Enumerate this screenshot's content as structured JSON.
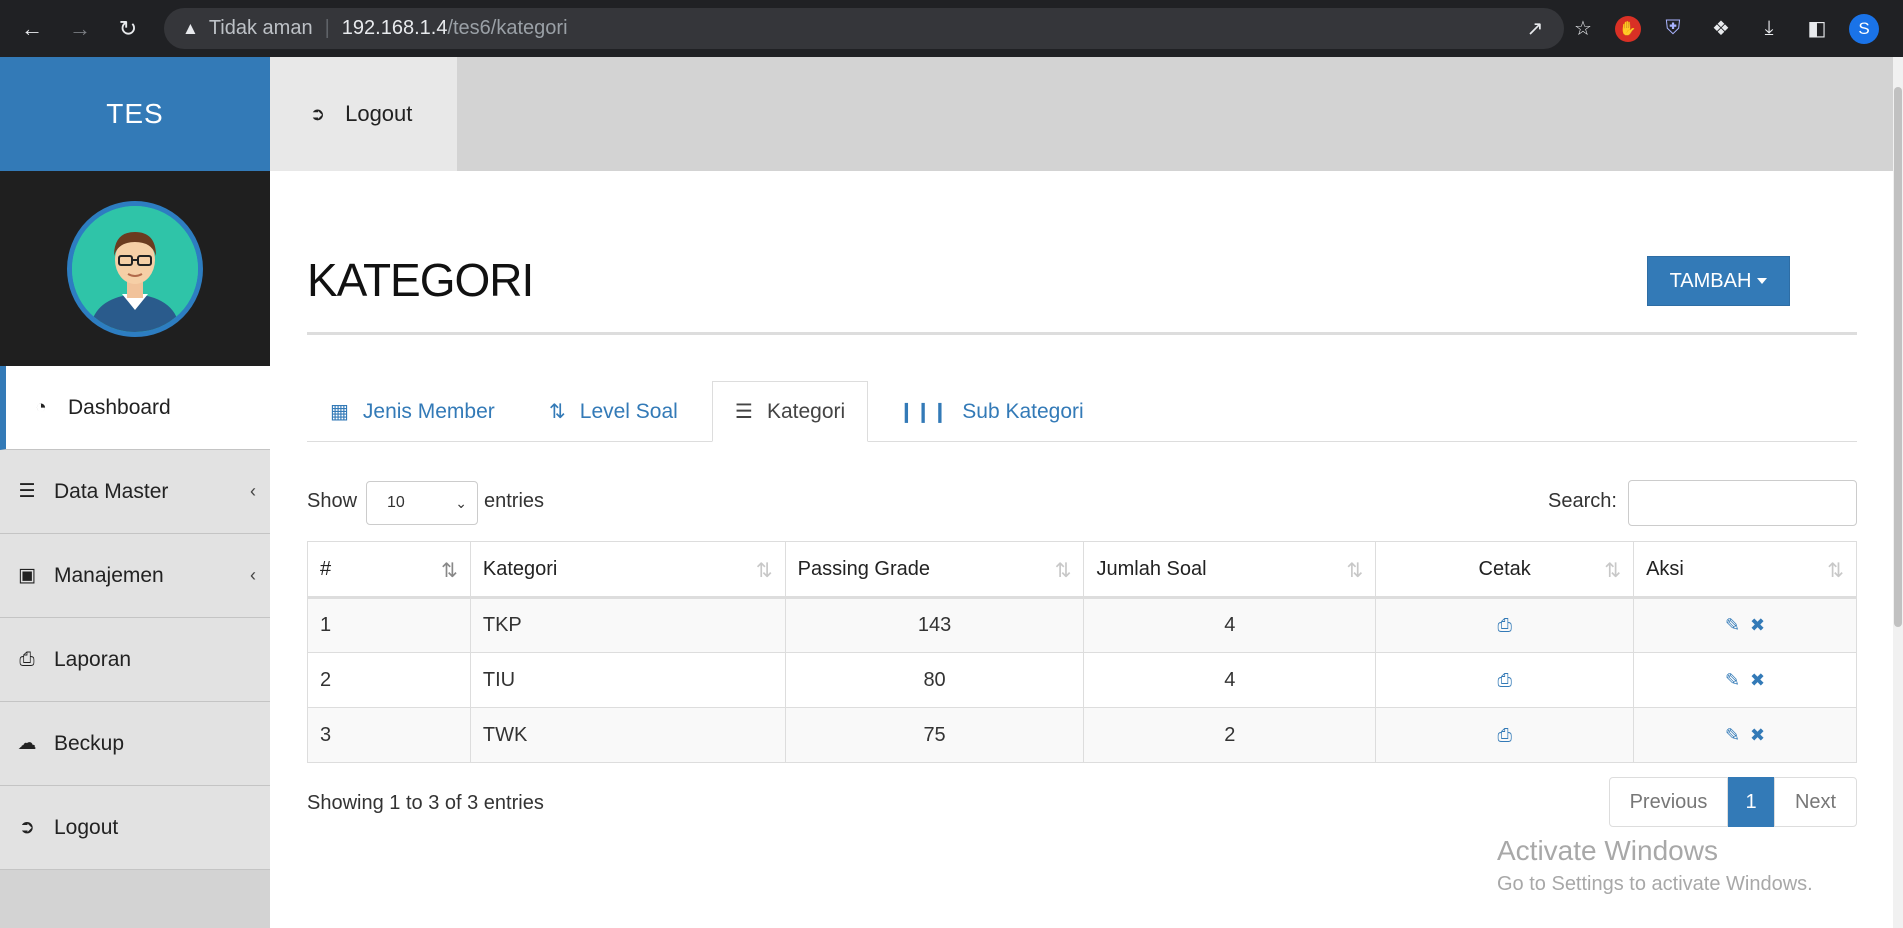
{
  "browser": {
    "insecure_label": "Tidak aman",
    "host": "192.168.1.4",
    "path": "/tes6/kategori",
    "profile_initial": "S"
  },
  "sidebar": {
    "brand": "TES",
    "items": [
      {
        "label": "Dashboard",
        "icon": "dashboard-icon",
        "active": true
      },
      {
        "label": "Data Master",
        "icon": "list-icon"
      },
      {
        "label": "Manajemen",
        "icon": "briefcase-icon"
      },
      {
        "label": "Laporan",
        "icon": "print-icon"
      },
      {
        "label": "Beckup",
        "icon": "cloud-download-icon"
      },
      {
        "label": "Logout",
        "icon": "sign-out-icon"
      }
    ]
  },
  "topbar": {
    "logout_label": "Logout"
  },
  "page": {
    "title": "KATEGORI",
    "add_button": "TAMBAH"
  },
  "tabs": [
    {
      "label": "Jenis Member",
      "icon": "qrcode-icon"
    },
    {
      "label": "Level Soal",
      "icon": "sort-amount-icon"
    },
    {
      "label": "Kategori",
      "icon": "list-icon",
      "active": true
    },
    {
      "label": "Sub Kategori",
      "icon": "barcode-icon"
    }
  ],
  "datatable": {
    "show_label": "Show",
    "length_value": "10",
    "entries_label": "entries",
    "search_label": "Search:",
    "columns": [
      "#",
      "Kategori",
      "Passing Grade",
      "Jumlah Soal",
      "Cetak",
      "Aksi"
    ],
    "rows": [
      {
        "no": "1",
        "kategori": "TKP",
        "passing_grade": "143",
        "jumlah_soal": "4"
      },
      {
        "no": "2",
        "kategori": "TIU",
        "passing_grade": "80",
        "jumlah_soal": "4"
      },
      {
        "no": "3",
        "kategori": "TWK",
        "passing_grade": "75",
        "jumlah_soal": "2"
      }
    ],
    "info": "Showing 1 to 3 of 3 entries",
    "pager": {
      "previous": "Previous",
      "current": "1",
      "next": "Next"
    }
  },
  "watermark": {
    "line1": "Activate Windows",
    "line2": "Go to Settings to activate Windows."
  },
  "colors": {
    "primary": "#337ab7",
    "sidebar_bg": "#d3d3d3",
    "profile_bg": "#1f1f1f",
    "chrome_bg": "#202124"
  }
}
